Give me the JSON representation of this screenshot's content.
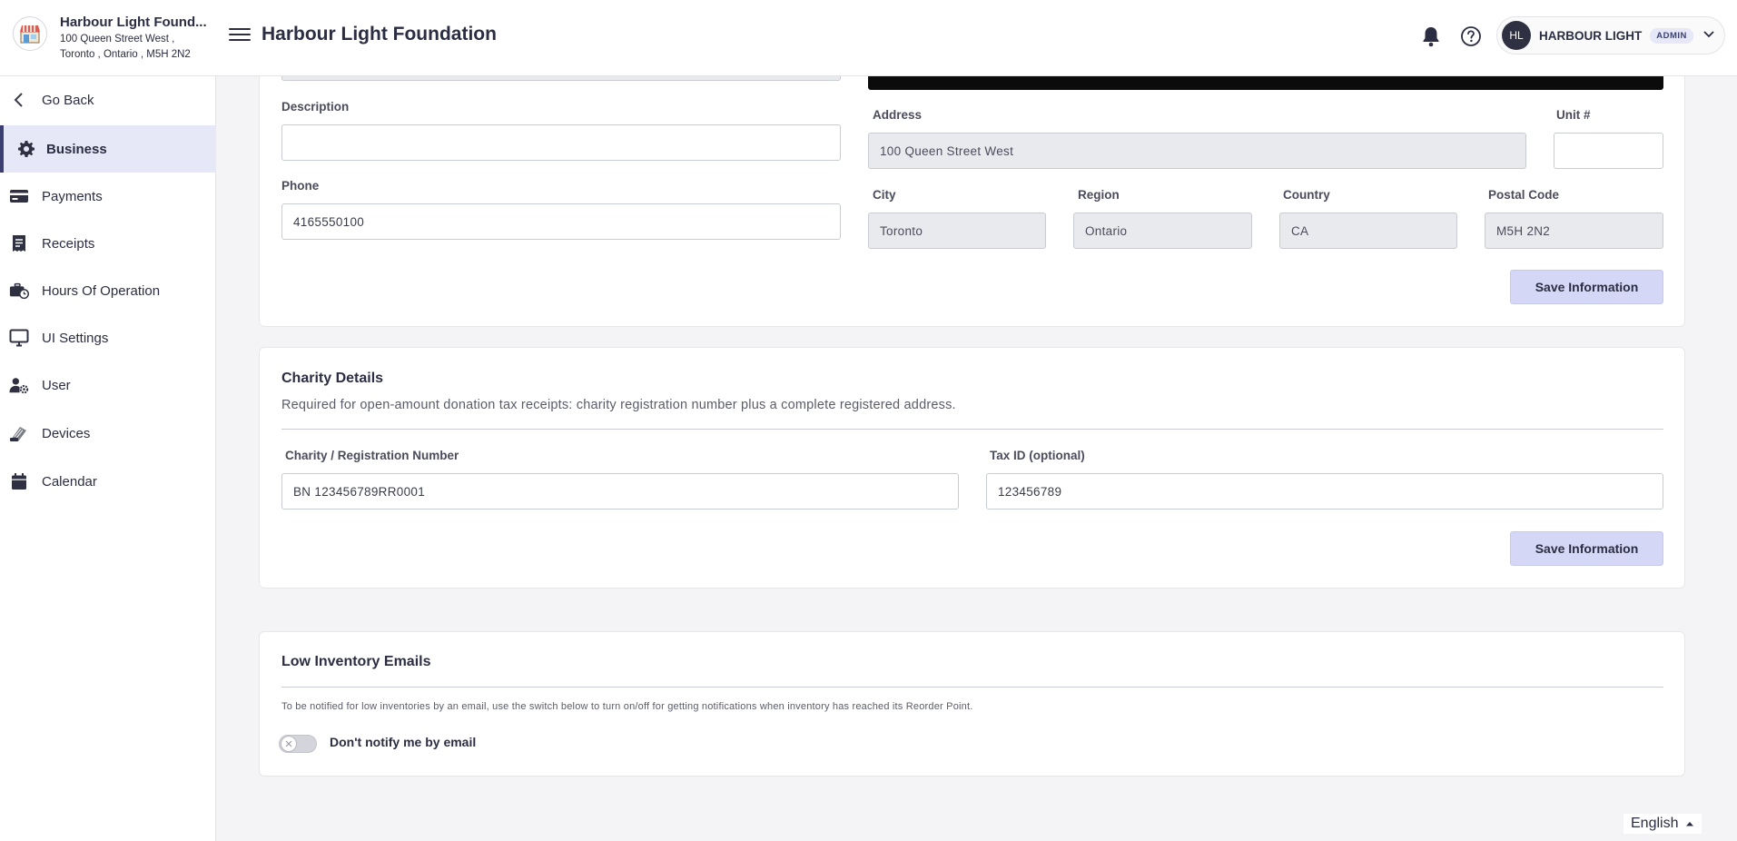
{
  "header": {
    "store_name": "Harbour Light Found...",
    "store_address_line1": "100 Queen Street West ,",
    "store_address_line2": "Toronto , Ontario , M5H 2N2",
    "title": "Harbour Light Foundation",
    "user_initials": "HL",
    "user_name": "HARBOUR LIGHT",
    "user_role": "ADMIN"
  },
  "sidebar": {
    "items": [
      {
        "label": "Go Back",
        "icon": "chevron-left-icon"
      },
      {
        "label": "Business",
        "icon": "gear-icon",
        "active": true
      },
      {
        "label": "Payments",
        "icon": "credit-card-icon"
      },
      {
        "label": "Receipts",
        "icon": "receipt-icon"
      },
      {
        "label": "Hours Of Operation",
        "icon": "business-clock-icon"
      },
      {
        "label": "UI Settings",
        "icon": "monitor-icon"
      },
      {
        "label": "User",
        "icon": "user-gear-icon"
      },
      {
        "label": "Devices",
        "icon": "card-reader-icon"
      },
      {
        "label": "Calendar",
        "icon": "calendar-icon"
      }
    ]
  },
  "business_info": {
    "description_label": "Description",
    "description_value": "",
    "phone_label": "Phone",
    "phone_value": "4165550100",
    "address_label": "Address",
    "address_value": "100 Queen Street West",
    "unit_label": "Unit #",
    "unit_value": "",
    "city_label": "City",
    "city_value": "Toronto",
    "region_label": "Region",
    "region_value": "Ontario",
    "country_label": "Country",
    "country_value": "CA",
    "postal_label": "Postal Code",
    "postal_value": "M5H 2N2",
    "save_label": "Save Information"
  },
  "charity": {
    "title": "Charity Details",
    "description": "Required for open-amount donation tax receipts: charity registration number plus a complete registered address.",
    "registration_label": "Charity / Registration Number",
    "registration_value": "BN 123456789RR0001",
    "tax_id_label": "Tax ID (optional)",
    "tax_id_value": "123456789",
    "save_label": "Save Information"
  },
  "low_inventory": {
    "title": "Low Inventory Emails",
    "description": "To be notified for low inventories by an email, use the switch below to turn on/off for getting notifications when inventory has reached its Reorder Point.",
    "toggle_label": "Don't notify me by email",
    "toggle_on": false
  },
  "footer": {
    "language": "English"
  },
  "colors": {
    "accent": "#3b3f72",
    "active_bg": "#e6e8f8",
    "button_bg": "#d4d7f5"
  }
}
